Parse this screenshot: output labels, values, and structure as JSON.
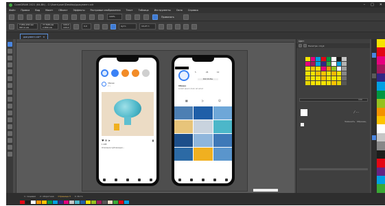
{
  "window": {
    "title": "CorelDRAW 2021 (64-Bit) - C:\\Users\\user\\Desktop\\документ.cdr",
    "minimize": "–",
    "maximize": "□",
    "close": "✕"
  },
  "menu": [
    "Файл",
    "Правка",
    "Вид",
    "Макет",
    "Объект",
    "Эффекты",
    "Растровые изображения",
    "Текст",
    "Таблица",
    "Инструменты",
    "Окно",
    "Справка"
  ],
  "toolbar": {
    "zoom": "100%",
    "snap": "Привязать"
  },
  "property_bar": {
    "x": "7.951,234 мм",
    "y": "587,2 мм",
    "width": "77,508 мм",
    "height": "2,849 мм",
    "scale_w": "100,0",
    "scale_h": "100,0",
    "rotation": "0,0",
    "style": "Ауто",
    "outline": "10,27 п"
  },
  "document_tab": {
    "name": "документ.cdr*",
    "close": "✕"
  },
  "phone1": {
    "brand": "Vitanex",
    "caption": "2 ч",
    "likes": "1 445",
    "text": "Описание публикации…"
  },
  "phone2": {
    "brand": "Vitanex",
    "followers": "5",
    "posts": "26",
    "following": "10",
    "name": "Vitanex",
    "bio": "Lorem ipsum dolor sit amet",
    "edit_button": "Edit Profile"
  },
  "page_tabs": [
    "1: лицевая",
    "2: оборотная",
    "Страница 3",
    "4: Фото"
  ],
  "docker": {
    "title": "Цвет",
    "palette_name": "Палитра: cmyk",
    "value": "100",
    "button1": "Заменить",
    "button2": "Образец"
  },
  "colors": {
    "accent": "#4a86e0",
    "bg": "#4a4a4a",
    "brain": "#4cb7c9",
    "gold": "#f0b020"
  }
}
